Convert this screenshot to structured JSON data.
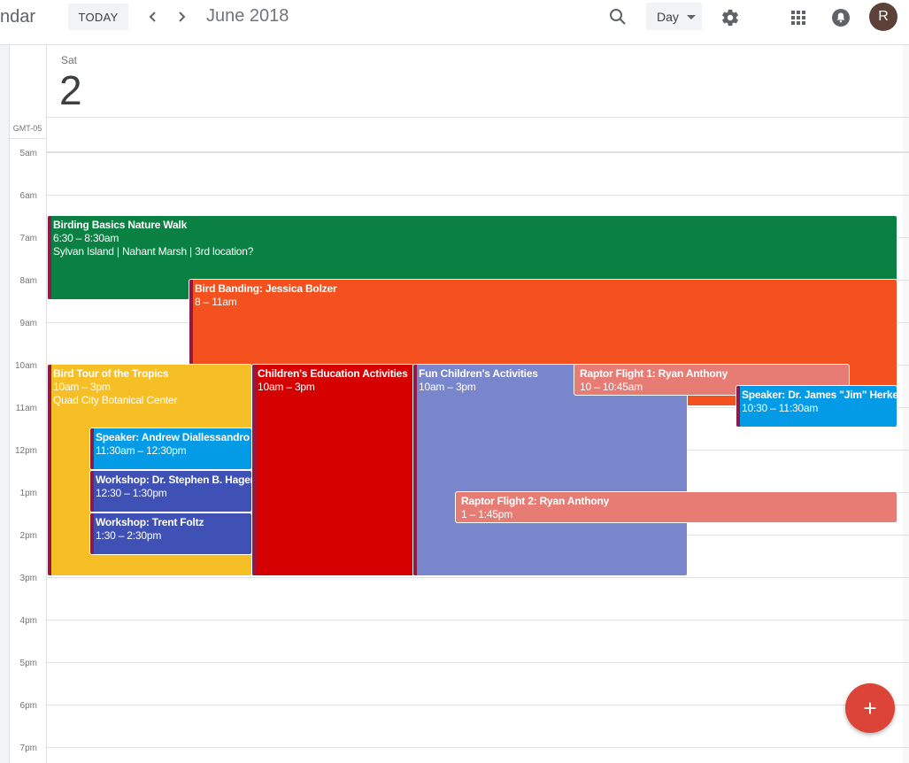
{
  "header": {
    "app_name": "ndar",
    "today_label": "TODAY",
    "month_label": "June 2018",
    "view_label": "Day",
    "avatar_initial": "R"
  },
  "day": {
    "name": "Sat",
    "number": "2"
  },
  "timezone": "GMT-05",
  "hours": [
    "5am",
    "6am",
    "7am",
    "8am",
    "9am",
    "10am",
    "11am",
    "12pm",
    "1pm",
    "2pm",
    "3pm",
    "4pm",
    "5pm",
    "6pm",
    "7pm"
  ],
  "events": [
    {
      "title": "Birding Basics Nature Walk",
      "time": "6:30 – 8:30am",
      "location": "Sylvan Island | Nahant Marsh | 3rd location?",
      "color": "#0b8043"
    },
    {
      "title": "Bird Banding: Jessica Bolzer",
      "time": "8 – 11am",
      "color": "#f4511e"
    },
    {
      "title": "Bird Tour of the Tropics",
      "time": "10am – 3pm",
      "location": "Quad City Botanical Center",
      "color": "#f6bf26"
    },
    {
      "title": "Children's Education Activities",
      "time": "10am – 3pm",
      "color": "#d50000"
    },
    {
      "title": "Fun Children's Activities",
      "time": "10am – 3pm",
      "color": "#7986cb"
    },
    {
      "title": "Raptor Flight 1: Ryan Anthony",
      "time": "10 – 10:45am",
      "color": "#e67c73"
    },
    {
      "title": "Speaker: Dr. James \"Jim\" Herkert",
      "time": "10:30 – 11:30am",
      "color": "#039be5"
    },
    {
      "title": "Speaker: Andrew Diallessandro",
      "time": "11:30am – 12:30pm",
      "color": "#039be5"
    },
    {
      "title": "Workshop: Dr. Stephen B. Hager",
      "time": "12:30 – 1:30pm",
      "color": "#3f51b5"
    },
    {
      "title": "Workshop: Trent Foltz",
      "time": "1:30 – 2:30pm",
      "color": "#3f51b5"
    },
    {
      "title": "Raptor Flight 2: Ryan Anthony",
      "time": "1 – 1:45pm",
      "color": "#e67c73"
    }
  ],
  "fab_label": "+"
}
